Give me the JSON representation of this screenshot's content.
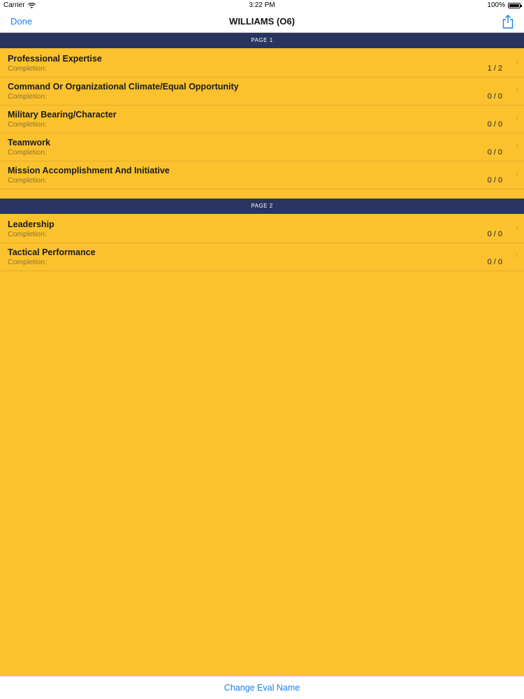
{
  "status_bar": {
    "carrier": "Carrier",
    "time": "3:22 PM",
    "battery": "100%"
  },
  "nav": {
    "done_label": "Done",
    "title": "WILLIAMS (O6)"
  },
  "sections": [
    {
      "header": "PAGE 1",
      "items": [
        {
          "title": "Professional Expertise",
          "subtitle": "Completion:",
          "count": "1 / 2"
        },
        {
          "title": "Command Or Organizational Climate/Equal Opportunity",
          "subtitle": "Completion:",
          "count": "0 / 0"
        },
        {
          "title": "Military Bearing/Character",
          "subtitle": "Completion:",
          "count": "0 / 0"
        },
        {
          "title": "Teamwork",
          "subtitle": "Completion:",
          "count": "0 / 0"
        },
        {
          "title": "Mission Accomplishment And Initiative",
          "subtitle": "Completion:",
          "count": "0 / 0"
        }
      ]
    },
    {
      "header": "PAGE 2",
      "items": [
        {
          "title": "Leadership",
          "subtitle": "Completion:",
          "count": "0 / 0"
        },
        {
          "title": "Tactical Performance",
          "subtitle": "Completion:",
          "count": "0 / 0"
        }
      ]
    }
  ],
  "bottom": {
    "change_label": "Change Eval Name"
  },
  "icons": {
    "wifi": "wifi-icon",
    "battery": "battery-icon",
    "share": "share-icon",
    "chevron": "chevron-right-icon"
  },
  "colors": {
    "background": "#FBC22E",
    "section_header": "#2a3460",
    "accent": "#1a7ff2"
  }
}
